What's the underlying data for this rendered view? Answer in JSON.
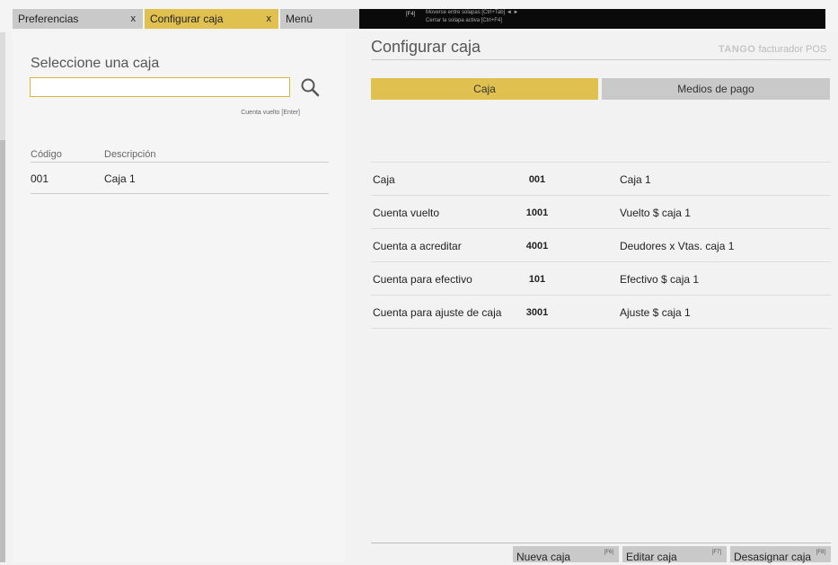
{
  "tabs": [
    {
      "label": "Preferencias",
      "close": "x"
    },
    {
      "label": "Configurar caja",
      "close": "x"
    },
    {
      "label": "Menú"
    }
  ],
  "keyboard_hint": {
    "key": "[F4]",
    "line1": "Moverse entre solapas [Ctrl+Tab] ◄ ►",
    "line2": "Cerrar la solapa activa [Ctrl+F4]"
  },
  "left": {
    "title": "Seleccione una caja",
    "search": {
      "value": "",
      "placeholder": ""
    },
    "search_hint": "Cuenta vuelto [Enter]",
    "columns": [
      "Código",
      "Descripción"
    ],
    "rows": [
      {
        "code": "001",
        "description": "Caja 1"
      }
    ]
  },
  "right": {
    "title": "Configurar caja",
    "brand": {
      "logo": "TANGO",
      "product": "facturador POS"
    },
    "tabs": [
      "Caja",
      "Medios de pago"
    ],
    "fields": [
      {
        "label": "Caja",
        "code": "001",
        "description": "Caja 1"
      },
      {
        "label": "Cuenta vuelto",
        "code": "1001",
        "description": "Vuelto $ caja 1"
      },
      {
        "label": "Cuenta a acreditar",
        "code": "4001",
        "description": "Deudores x Vtas. caja 1"
      },
      {
        "label": "Cuenta para efectivo",
        "code": "101",
        "description": "Efectivo $ caja 1"
      },
      {
        "label": "Cuenta para ajuste de caja",
        "code": "3001",
        "description": "Ajuste $ caja 1"
      }
    ],
    "buttons": [
      {
        "label": "Nueva caja",
        "key": "[F6]"
      },
      {
        "label": "Editar caja",
        "key": "[F7]"
      },
      {
        "label": "Desasignar caja",
        "key": "[F8]"
      }
    ]
  },
  "colors": {
    "accent": "#e0c14f",
    "tab_inactive": "#c9c9c9",
    "hint_bar": "#0a0a0a"
  },
  "icons": [
    "search-icon"
  ]
}
